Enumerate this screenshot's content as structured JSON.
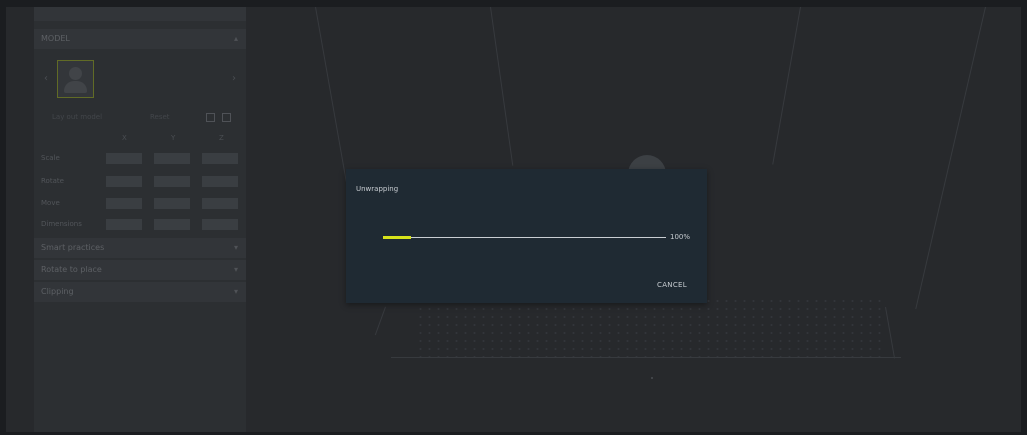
{
  "sidebar": {
    "model_header": "MODEL",
    "thumbnail_icon": "avatar-icon",
    "toolbar": {
      "left_label": "Lay out model",
      "right_label": "Reset"
    },
    "columns": [
      "X",
      "Y",
      "Z"
    ],
    "rows": [
      {
        "label": "Scale"
      },
      {
        "label": "Rotate"
      },
      {
        "label": "Move"
      },
      {
        "label": "Dimensions"
      }
    ],
    "sections": [
      {
        "label": "Smart practices"
      },
      {
        "label": "Rotate to place"
      },
      {
        "label": "Clipping"
      }
    ]
  },
  "dialog": {
    "title": "Unwrapping",
    "progress": 0.1,
    "percent_label": "100%",
    "cancel_label": "CANCEL",
    "accent_color": "#d7e31b"
  }
}
